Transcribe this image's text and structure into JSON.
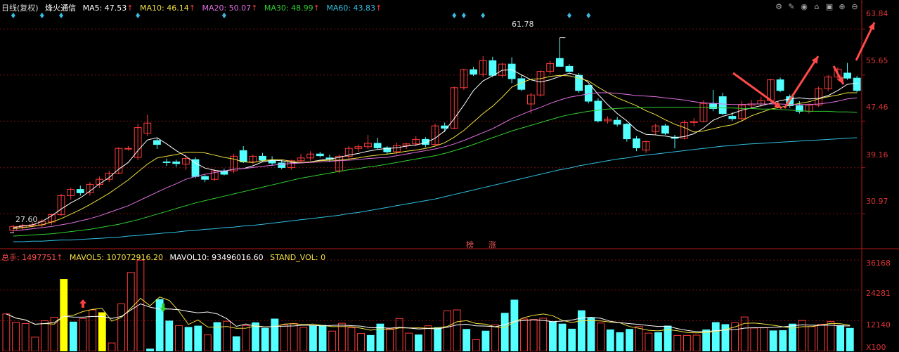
{
  "header": {
    "period": "日线(复权)",
    "stock_name": "烽火通信",
    "ma": [
      {
        "label": "MA5: 47.53",
        "color": "#ffffff"
      },
      {
        "label": "MA10: 46.14",
        "color": "#f0e040"
      },
      {
        "label": "MA20: 50.07",
        "color": "#e070e0"
      },
      {
        "label": "MA30: 48.99",
        "color": "#30d030"
      },
      {
        "label": "MA60: 43.83",
        "color": "#30c0e0"
      }
    ]
  },
  "toolbar": [
    "gear-icon",
    "edit-icon",
    "eye-icon",
    "home-icon",
    "lock-icon",
    "plus-icon",
    "minus-icon"
  ],
  "volume_header": {
    "total": "总手: 1497751",
    "mavol5": "MAVOL5: 107072916.20",
    "mavol10": "MAVOL10: 93496016.60",
    "stand_vol": "STAND_VOL: 0"
  },
  "annotations": {
    "high_label": "61.78",
    "low_label": "27.60",
    "tag1": "榜",
    "tag2": "涨"
  },
  "colors": {
    "up": "#ff3b3b",
    "down": "#54ffff",
    "grid": "#7a1010",
    "axis_text": "#e03030",
    "volume_highlight": "#ffff00"
  },
  "chart_data": [
    {
      "type": "candlestick",
      "title": "",
      "y_ticks": [
        "63.84",
        "55.65",
        "47.46",
        "39.16",
        "30.97"
      ],
      "ylim": [
        25.0,
        65.0
      ],
      "ohlc": [
        [
          28.0,
          29.0,
          27.6,
          28.7
        ],
        [
          28.6,
          29.2,
          28.0,
          28.9
        ],
        [
          28.8,
          29.5,
          28.6,
          29.0
        ],
        [
          29.0,
          30.0,
          28.6,
          29.6
        ],
        [
          29.5,
          31.0,
          29.0,
          30.8
        ],
        [
          30.8,
          34.5,
          30.6,
          34.2
        ],
        [
          34.2,
          35.6,
          33.5,
          35.3
        ],
        [
          35.3,
          36.0,
          34.2,
          34.7
        ],
        [
          34.7,
          36.6,
          34.2,
          36.2
        ],
        [
          36.2,
          37.6,
          35.6,
          37.1
        ],
        [
          37.1,
          38.6,
          36.6,
          38.2
        ],
        [
          38.2,
          42.8,
          38.0,
          42.6
        ],
        [
          42.6,
          43.0,
          42.2,
          42.6
        ],
        [
          41.0,
          47.0,
          40.5,
          46.3
        ],
        [
          45.3,
          48.6,
          44.8,
          47.1
        ],
        [
          44.0,
          44.5,
          42.5,
          43.3
        ],
        [
          40.2,
          40.8,
          39.5,
          40.1
        ],
        [
          40.2,
          40.6,
          39.3,
          39.9
        ],
        [
          39.8,
          41.5,
          38.8,
          40.8
        ],
        [
          40.6,
          41.0,
          37.3,
          37.6
        ],
        [
          37.6,
          37.9,
          36.6,
          37.1
        ],
        [
          37.1,
          38.9,
          36.8,
          38.6
        ],
        [
          38.6,
          39.0,
          37.8,
          38.0
        ],
        [
          38.6,
          41.6,
          38.2,
          41.2
        ],
        [
          42.2,
          43.0,
          40.0,
          40.2
        ],
        [
          40.2,
          41.5,
          39.8,
          41.2
        ],
        [
          41.2,
          41.8,
          40.2,
          40.5
        ],
        [
          40.4,
          41.2,
          39.5,
          40.0
        ],
        [
          40.0,
          40.5,
          38.9,
          39.2
        ],
        [
          39.2,
          40.6,
          38.8,
          40.4
        ],
        [
          40.4,
          41.6,
          40.0,
          40.9
        ],
        [
          40.9,
          42.1,
          40.4,
          41.6
        ],
        [
          41.6,
          42.0,
          41.0,
          41.3
        ],
        [
          40.9,
          41.5,
          40.2,
          40.7
        ],
        [
          38.6,
          41.5,
          38.2,
          41.2
        ],
        [
          41.2,
          43.0,
          40.6,
          42.6
        ],
        [
          42.6,
          43.3,
          42.0,
          42.9
        ],
        [
          42.9,
          45.0,
          42.5,
          43.5
        ],
        [
          43.5,
          44.5,
          42.5,
          42.7
        ],
        [
          42.7,
          43.0,
          41.5,
          42.0
        ],
        [
          42.0,
          43.6,
          41.6,
          43.1
        ],
        [
          43.1,
          43.6,
          42.5,
          43.4
        ],
        [
          43.4,
          44.8,
          43.0,
          44.2
        ],
        [
          44.2,
          44.6,
          42.8,
          43.3
        ],
        [
          43.3,
          47.0,
          43.0,
          46.6
        ],
        [
          46.6,
          47.2,
          45.5,
          46.2
        ],
        [
          46.2,
          53.6,
          46.0,
          53.4
        ],
        [
          53.4,
          56.8,
          53.0,
          56.6
        ],
        [
          56.6,
          57.1,
          55.5,
          55.8
        ],
        [
          55.8,
          59.0,
          55.3,
          58.2
        ],
        [
          58.2,
          58.9,
          55.3,
          55.6
        ],
        [
          55.6,
          57.8,
          55.2,
          57.6
        ],
        [
          57.6,
          58.8,
          54.2,
          55.0
        ],
        [
          55.0,
          55.6,
          52.8,
          53.1
        ],
        [
          50.5,
          52.5,
          48.8,
          52.1
        ],
        [
          52.1,
          56.5,
          51.8,
          56.3
        ],
        [
          56.3,
          58.2,
          55.8,
          57.7
        ],
        [
          58.6,
          61.8,
          57.5,
          57.2
        ],
        [
          57.2,
          57.6,
          56.2,
          56.3
        ],
        [
          55.6,
          56.0,
          52.5,
          52.9
        ],
        [
          53.8,
          54.0,
          50.6,
          51.0
        ],
        [
          51.0,
          51.5,
          47.2,
          47.5
        ],
        [
          47.5,
          48.3,
          47.0,
          47.8
        ],
        [
          47.6,
          48.2,
          46.5,
          46.9
        ],
        [
          46.9,
          47.1,
          43.8,
          44.3
        ],
        [
          44.3,
          44.8,
          42.1,
          42.7
        ],
        [
          42.3,
          44.0,
          41.8,
          43.8
        ],
        [
          45.6,
          47.0,
          45.0,
          46.6
        ],
        [
          46.6,
          47.0,
          45.0,
          45.3
        ],
        [
          44.6,
          45.0,
          42.6,
          44.4
        ],
        [
          44.4,
          47.6,
          44.2,
          47.2
        ],
        [
          47.2,
          48.0,
          46.5,
          47.4
        ],
        [
          47.4,
          51.2,
          47.2,
          50.6
        ],
        [
          50.6,
          53.0,
          49.2,
          49.7
        ],
        [
          51.8,
          52.5,
          48.5,
          48.8
        ],
        [
          48.3,
          49.0,
          47.5,
          47.9
        ],
        [
          47.9,
          51.0,
          47.5,
          50.3
        ],
        [
          50.3,
          51.2,
          49.8,
          50.5
        ],
        [
          50.5,
          51.8,
          50.0,
          51.1
        ],
        [
          51.1,
          55.0,
          50.8,
          54.8
        ],
        [
          54.8,
          55.2,
          52.6,
          52.9
        ],
        [
          51.8,
          52.2,
          49.8,
          50.2
        ],
        [
          50.2,
          51.0,
          48.8,
          49.2
        ],
        [
          49.2,
          50.6,
          48.8,
          50.3
        ],
        [
          50.3,
          53.6,
          50.0,
          53.2
        ],
        [
          53.2,
          55.6,
          52.8,
          55.3
        ],
        [
          55.3,
          57.0,
          54.8,
          56.7
        ],
        [
          56.0,
          57.8,
          54.8,
          55.1
        ],
        [
          55.1,
          55.5,
          52.6,
          52.9
        ]
      ],
      "ma_series": [
        {
          "name": "MA5",
          "color": "#ffffff",
          "values": [
            28.5,
            28.8,
            29.0,
            29.6,
            30.6,
            31.8,
            32.9,
            33.8,
            35.0,
            36.3,
            37.4,
            38.9,
            40.1,
            42.2,
            44.1,
            44.5,
            43.4,
            42.2,
            41.2,
            40.0,
            39.1,
            38.7,
            38.5,
            38.9,
            39.0,
            39.5,
            40.2,
            40.5,
            40.4,
            40.1,
            40.0,
            40.2,
            40.5,
            40.7,
            41.0,
            41.4,
            41.7,
            42.1,
            42.4,
            42.6,
            42.7,
            43.0,
            43.2,
            43.6,
            44.4,
            45.7,
            47.9,
            50.3,
            52.9,
            54.6,
            55.5,
            56.5,
            56.6,
            55.7,
            54.8,
            54.4,
            54.8,
            55.4,
            56.0,
            55.5,
            54.3,
            52.2,
            50.4,
            48.8,
            47.5,
            45.9,
            45.1,
            45.0,
            44.8,
            44.5,
            44.7,
            45.2,
            46.2,
            47.6,
            48.3,
            48.8,
            49.4,
            49.8,
            50.2,
            50.6,
            51.1,
            51.4,
            51.6,
            51.4,
            51.5,
            52.0,
            52.9,
            54.0,
            54.2
          ]
        },
        {
          "name": "MA10",
          "color": "#f0e040",
          "values": [
            28.3,
            28.5,
            28.7,
            29.0,
            29.5,
            30.1,
            30.9,
            31.7,
            32.6,
            33.6,
            34.6,
            35.8,
            37.0,
            38.4,
            39.8,
            40.9,
            41.2,
            41.5,
            41.9,
            41.9,
            41.8,
            41.4,
            41.0,
            40.7,
            40.2,
            40.1,
            40.4,
            40.6,
            40.6,
            40.3,
            40.1,
            40.2,
            40.4,
            40.5,
            40.5,
            40.7,
            40.9,
            41.2,
            41.4,
            41.6,
            41.8,
            42.1,
            42.3,
            42.6,
            43.0,
            43.6,
            44.6,
            45.8,
            47.3,
            48.8,
            50.1,
            51.7,
            53.5,
            54.3,
            54.9,
            55.0,
            55.4,
            55.6,
            55.5,
            55.1,
            54.6,
            53.5,
            52.5,
            51.6,
            50.9,
            50.2,
            49.3,
            48.6,
            47.7,
            46.9,
            46.3,
            45.5,
            45.7,
            46.1,
            46.5,
            46.8,
            47.5,
            48.4,
            49.0,
            49.6,
            49.9,
            50.3,
            50.6,
            50.9,
            51.4,
            51.8,
            52.1,
            52.5,
            52.5
          ]
        },
        {
          "name": "MA20",
          "color": "#e070e0",
          "values": [
            28.0,
            28.1,
            28.3,
            28.5,
            28.7,
            29.0,
            29.3,
            29.7,
            30.1,
            30.6,
            31.2,
            31.8,
            32.4,
            33.2,
            34.0,
            34.8,
            35.6,
            36.3,
            37.1,
            37.6,
            38.0,
            38.3,
            38.6,
            38.9,
            39.0,
            39.2,
            39.4,
            39.6,
            39.8,
            39.9,
            40.0,
            40.1,
            40.2,
            40.3,
            40.4,
            40.5,
            40.6,
            40.8,
            40.9,
            41.0,
            41.3,
            41.6,
            41.9,
            42.2,
            42.5,
            42.9,
            43.4,
            44.0,
            44.7,
            45.4,
            46.1,
            47.0,
            47.9,
            48.6,
            49.3,
            49.9,
            50.6,
            51.2,
            51.7,
            52.0,
            52.3,
            52.5,
            52.5,
            52.4,
            52.2,
            52.0,
            51.9,
            51.8,
            51.6,
            51.4,
            51.2,
            50.9,
            50.7,
            50.6,
            50.5,
            50.4,
            50.4,
            50.5,
            50.5,
            50.5,
            50.5,
            50.4,
            50.4,
            50.4,
            50.5,
            50.7,
            51.0,
            51.4,
            51.6
          ]
        },
        {
          "name": "MA30",
          "color": "#30d030",
          "values": [
            27.0,
            27.1,
            27.2,
            27.3,
            27.4,
            27.6,
            27.8,
            28.0,
            28.2,
            28.5,
            28.8,
            29.1,
            29.5,
            29.9,
            30.4,
            30.9,
            31.4,
            31.9,
            32.4,
            32.9,
            33.3,
            33.7,
            34.1,
            34.5,
            34.9,
            35.3,
            35.7,
            36.1,
            36.5,
            36.9,
            37.3,
            37.6,
            37.9,
            38.2,
            38.5,
            38.8,
            39.0,
            39.3,
            39.5,
            39.8,
            40.1,
            40.4,
            40.7,
            41.0,
            41.3,
            41.7,
            42.2,
            42.7,
            43.3,
            43.9,
            44.5,
            45.1,
            45.7,
            46.2,
            46.7,
            47.2,
            47.7,
            48.2,
            48.6,
            48.9,
            49.2,
            49.4,
            49.6,
            49.7,
            49.8,
            49.8,
            49.9,
            49.9,
            49.9,
            49.9,
            49.9,
            49.9,
            49.9,
            49.9,
            49.8,
            49.8,
            49.7,
            49.7,
            49.6,
            49.6,
            49.5,
            49.4,
            49.3,
            49.2,
            49.2,
            49.2,
            49.1,
            49.1,
            49.0
          ]
        },
        {
          "name": "MA60",
          "color": "#30c0e0",
          "values": [
            26.0,
            26.0,
            26.1,
            26.1,
            26.2,
            26.3,
            26.3,
            26.4,
            26.5,
            26.6,
            26.7,
            26.8,
            27.0,
            27.1,
            27.3,
            27.4,
            27.6,
            27.7,
            27.9,
            28.0,
            28.2,
            28.3,
            28.5,
            28.6,
            28.8,
            28.9,
            29.1,
            29.3,
            29.5,
            29.7,
            29.9,
            30.1,
            30.3,
            30.5,
            30.7,
            31.0,
            31.2,
            31.5,
            31.8,
            32.1,
            32.4,
            32.7,
            33.0,
            33.3,
            33.6,
            34.0,
            34.4,
            34.8,
            35.2,
            35.6,
            36.0,
            36.4,
            36.8,
            37.2,
            37.6,
            38.0,
            38.4,
            38.8,
            39.1,
            39.5,
            39.8,
            40.1,
            40.4,
            40.7,
            40.9,
            41.2,
            41.4,
            41.6,
            41.8,
            42.0,
            42.2,
            42.4,
            42.6,
            42.8,
            43.0,
            43.1,
            43.3,
            43.4,
            43.5,
            43.6,
            43.7,
            43.8,
            43.9,
            44.0,
            44.1,
            44.2,
            44.3,
            44.4,
            44.5
          ]
        }
      ]
    },
    {
      "type": "bar",
      "title": "",
      "y_ticks": [
        "36168",
        "24281",
        "12140",
        "X100"
      ],
      "ylim": [
        0,
        36168
      ],
      "highlighted_bars": [
        6,
        10
      ],
      "values": [
        14800,
        11500,
        11000,
        5600,
        12100,
        13500,
        28500,
        11600,
        13000,
        16400,
        15300,
        3300,
        18800,
        31200,
        36100,
        900,
        20500,
        12000,
        10200,
        9500,
        10000,
        6500,
        11400,
        11900,
        5800,
        10200,
        11300,
        9100,
        12800,
        10500,
        11000,
        9500,
        10000,
        10300,
        8000,
        11100,
        9300,
        7100,
        6300,
        10800,
        9000,
        13000,
        7200,
        6500,
        10100,
        9400,
        16000,
        16400,
        8700,
        4600,
        8000,
        10500,
        15100,
        20300,
        12800,
        12600,
        13100,
        11700,
        10800,
        8800,
        16100,
        13300,
        11200,
        8500,
        7400,
        8700,
        9800,
        7200,
        7400,
        10000,
        6300,
        6300,
        6400,
        8500,
        11400,
        10600,
        11300,
        13600,
        9200,
        9400,
        8100,
        8200,
        10800,
        12200,
        9800,
        10700,
        11800,
        10200,
        9100
      ]
    }
  ]
}
